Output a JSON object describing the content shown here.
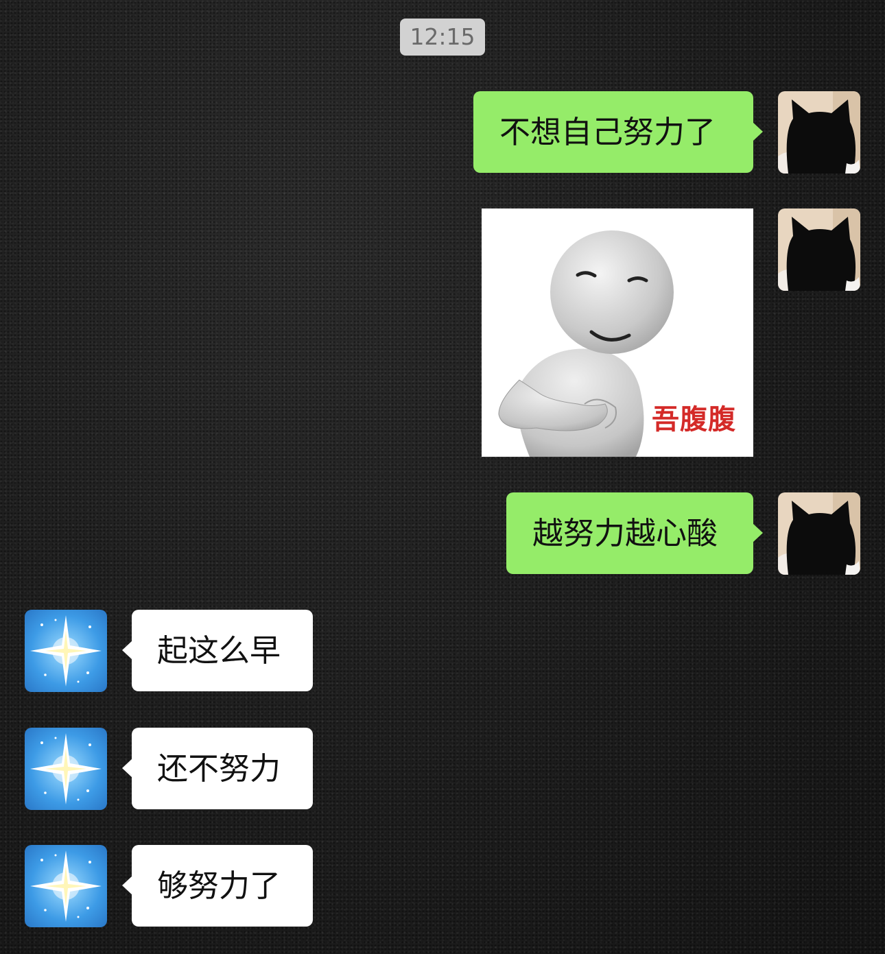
{
  "chat": {
    "timestamp": "12:15",
    "messages": [
      {
        "from": "me",
        "type": "text",
        "text": "不想自己努力了"
      },
      {
        "from": "me",
        "type": "sticker",
        "caption": "吾腹腹"
      },
      {
        "from": "me",
        "type": "text",
        "text": "越努力越心酸"
      },
      {
        "from": "other",
        "type": "text",
        "text": "起这么早"
      },
      {
        "from": "other",
        "type": "text",
        "text": "还不努力"
      },
      {
        "from": "other",
        "type": "text",
        "text": "够努力了"
      }
    ]
  },
  "avatars": {
    "me": "black-cat-avatar",
    "other": "blue-sparkle-star-avatar"
  },
  "colors": {
    "sent_bubble": "#95ec69",
    "received_bubble": "#ffffff",
    "timestamp_bg": "#d2d2d2",
    "sticker_caption": "#d42a28"
  }
}
